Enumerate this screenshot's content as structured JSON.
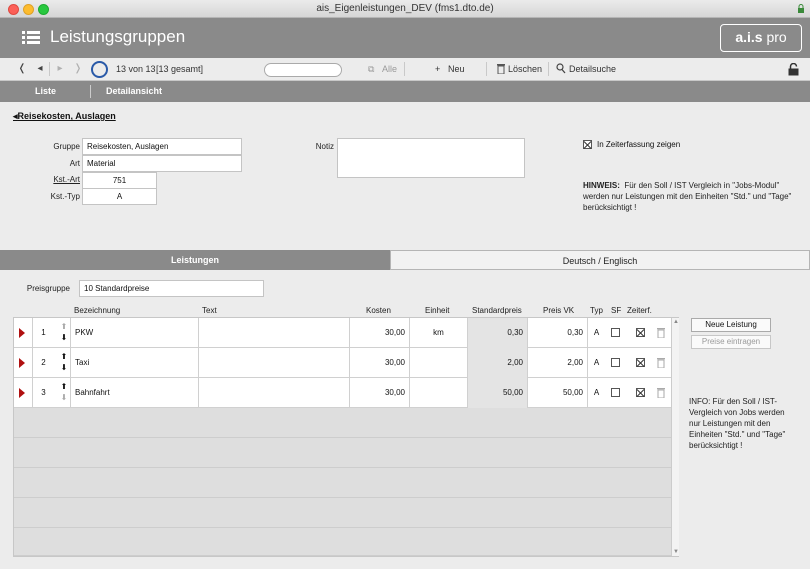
{
  "window": {
    "title": "ais_Eigenleistungen_DEV (fms1.dto.de)"
  },
  "header": {
    "title": "Leistungsgruppen",
    "brand": "a.i.s",
    "brand_suffix": "pro"
  },
  "toolbar": {
    "record_position": "13 von 13",
    "record_total": "[13 gesamt]",
    "search_value": "",
    "all_label": "Alle",
    "new_label": "Neu",
    "delete_label": "Löschen",
    "detail_search_label": "Detailsuche"
  },
  "tabs": {
    "list": "Liste",
    "detail": "Detailansicht"
  },
  "breadcrumb": "Reisekosten, Auslagen",
  "form": {
    "gruppe_label": "Gruppe",
    "gruppe_value": "Reisekosten, Auslagen",
    "art_label": "Art",
    "art_value": "Material",
    "kstart_label": "Kst.-Art",
    "kstart_value": "751",
    "ksttyp_label": "Kst.-Typ",
    "ksttyp_value": "A",
    "notiz_label": "Notiz",
    "notiz_value": "",
    "zeiterfassung_label": "In Zeiterfassung zeigen",
    "zeiterfassung_checked": true,
    "hint_label": "HINWEIS:",
    "hint_text": "Für den Soll / IST Vergleich in \"Jobs-Modul\" werden nur Leistungen mit den Einheiten \"Std.\" und \"Tage\" berücksichtigt !"
  },
  "panel_tabs": {
    "active": "Leistungen",
    "inactive": "Deutsch / Englisch"
  },
  "preisgruppe": {
    "label": "Preisgruppe",
    "value": "10 Standardpreise"
  },
  "columns": {
    "bezeichnung": "Bezeichnung",
    "text": "Text",
    "kosten": "Kosten",
    "einheit": "Einheit",
    "standardpreis": "Standardpreis",
    "preis_vk": "Preis VK",
    "typ": "Typ",
    "sf": "SF",
    "zeiterf": "Zeiterf."
  },
  "rows": [
    {
      "num": "1",
      "bezeichnung": "PKW",
      "text": "",
      "kosten": "30,00",
      "einheit": "km",
      "standardpreis": "0,30",
      "preis_vk": "0,30",
      "typ": "A",
      "sf": false,
      "zeiterf": true
    },
    {
      "num": "2",
      "bezeichnung": "Taxi",
      "text": "",
      "kosten": "30,00",
      "einheit": "",
      "standardpreis": "2,00",
      "preis_vk": "2,00",
      "typ": "A",
      "sf": false,
      "zeiterf": true
    },
    {
      "num": "3",
      "bezeichnung": "Bahnfahrt",
      "text": "",
      "kosten": "30,00",
      "einheit": "",
      "standardpreis": "50,00",
      "preis_vk": "50,00",
      "typ": "A",
      "sf": false,
      "zeiterf": true
    }
  ],
  "buttons": {
    "new_service": "Neue Leistung",
    "enter_prices": "Preise eintragen"
  },
  "info": "INFO: Für den Soll / IST-Vergleich von Jobs werden nur Leistungen mit den Einheiten \"Std.\" und \"Tage\" berücksichtigt !",
  "colors": {
    "header_bg": "#8a8a8a",
    "accent_blue": "#2a5aa8",
    "marker_red": "#b01010"
  }
}
